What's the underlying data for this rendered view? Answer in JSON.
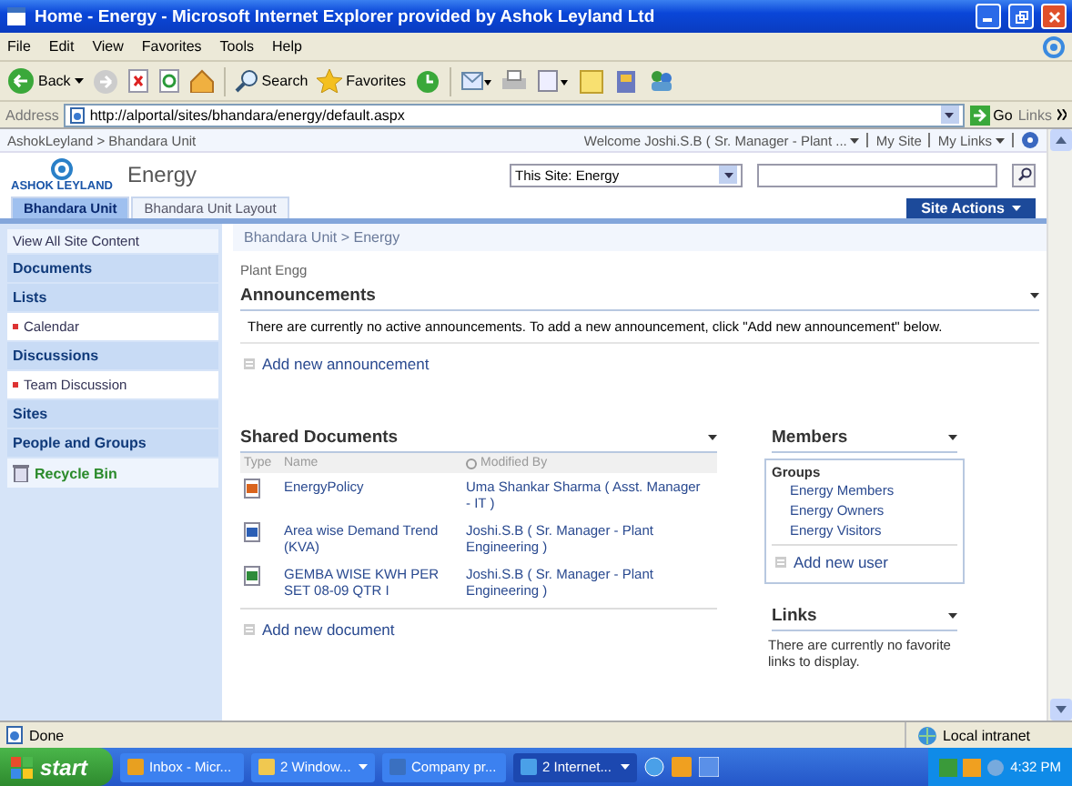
{
  "window": {
    "title": "Home - Energy - Microsoft Internet Explorer provided by Ashok Leyland Ltd"
  },
  "menu": [
    "File",
    "Edit",
    "View",
    "Favorites",
    "Tools",
    "Help"
  ],
  "toolbar": {
    "back": "Back",
    "search": "Search",
    "favorites": "Favorites"
  },
  "address": {
    "label": "Address",
    "url": "http://alportal/sites/bhandara/energy/default.aspx",
    "go": "Go",
    "links": "Links"
  },
  "site": {
    "breadcrumb": "AshokLeyland > Bhandara Unit",
    "welcome": "Welcome Joshi.S.B ( Sr. Manager - Plant ...",
    "my_site": "My Site",
    "my_links": "My Links",
    "logo_text": "ASHOK LEYLAND",
    "title": "Energy",
    "search_scope": "This Site: Energy",
    "site_actions": "Site Actions"
  },
  "tabs": [
    {
      "label": "Bhandara Unit",
      "selected": true
    },
    {
      "label": "Bhandara Unit Layout",
      "selected": false
    }
  ],
  "quick_launch": [
    {
      "kind": "link",
      "label": "View All Site Content"
    },
    {
      "kind": "heading",
      "label": "Documents"
    },
    {
      "kind": "heading",
      "label": "Lists"
    },
    {
      "kind": "sub",
      "label": "Calendar"
    },
    {
      "kind": "heading",
      "label": "Discussions"
    },
    {
      "kind": "sub",
      "label": "Team Discussion"
    },
    {
      "kind": "heading",
      "label": "Sites"
    },
    {
      "kind": "heading",
      "label": "People and Groups"
    },
    {
      "kind": "recycle",
      "label": "Recycle Bin"
    }
  ],
  "page": {
    "breadcrumb": "Bhandara Unit > Energy",
    "title": "Plant Engg"
  },
  "announcements": {
    "title": "Announcements",
    "message": "There are currently no active announcements. To add a new announcement, click \"Add new announcement\" below.",
    "add": "Add new announcement"
  },
  "shared_documents": {
    "title": "Shared Documents",
    "columns": [
      "Type",
      "Name",
      "Modified By"
    ],
    "rows": [
      {
        "kind": "presentation",
        "name": "EnergyPolicy",
        "modified_by": "Uma Shankar Sharma ( Asst. Manager - IT )"
      },
      {
        "kind": "document",
        "name": "Area wise Demand Trend (KVA)",
        "modified_by": "Joshi.S.B ( Sr. Manager - Plant Engineering )"
      },
      {
        "kind": "spreadsheet",
        "name": "GEMBA WISE KWH PER SET 08-09 QTR I",
        "modified_by": "Joshi.S.B ( Sr. Manager - Plant Engineering )"
      }
    ],
    "add": "Add new document"
  },
  "members": {
    "title": "Members",
    "groups_label": "Groups",
    "groups": [
      "Energy Members",
      "Energy Owners",
      "Energy Visitors"
    ],
    "add": "Add new user"
  },
  "links": {
    "title": "Links",
    "message": "There are currently no favorite links to display."
  },
  "status_bar": {
    "text": "Done",
    "zone": "Local intranet"
  },
  "taskbar": {
    "start": "start",
    "tasks": [
      {
        "kind": "mail",
        "label": "Inbox - Micr...",
        "menu": false,
        "selected": false
      },
      {
        "kind": "folder",
        "label": "2 Window...",
        "menu": true,
        "selected": false
      },
      {
        "kind": "document",
        "label": "Company pr...",
        "menu": false,
        "selected": false
      },
      {
        "kind": "browser",
        "label": "2 Internet...",
        "menu": true,
        "selected": true
      }
    ],
    "clock": "4:32 PM"
  }
}
